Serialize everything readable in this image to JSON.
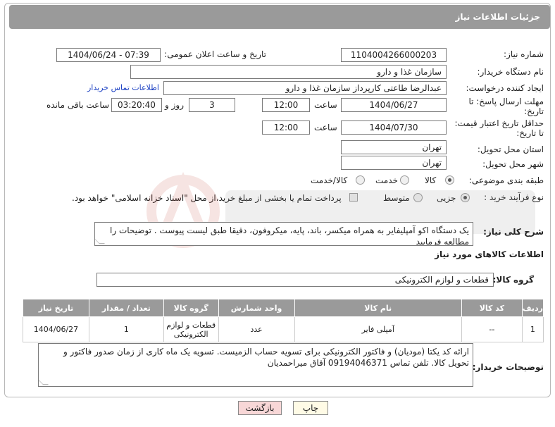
{
  "header": {
    "title": "جزئیات اطلاعات نیاز"
  },
  "form": {
    "need_number": {
      "label": "شماره نیاز:",
      "value": "1104004266000203"
    },
    "announce_datetime": {
      "label": "تاریخ و ساعت اعلان عمومی:",
      "value": "1404/06/24 - 07:39"
    },
    "buyer_org": {
      "label": "نام دستگاه خریدار:",
      "value": "سازمان غذا و دارو"
    },
    "requester": {
      "label": "ایجاد کننده درخواست:",
      "value": "عبدالرضا طاعتی کارپرداز سازمان غذا و دارو",
      "contact_link": "اطلاعات تماس خریدار"
    },
    "reply_deadline": {
      "label_line1": "مهلت ارسال پاسخ: تا",
      "label_line2": "تاریخ:",
      "date": "1404/06/27",
      "time_label": "ساعت",
      "time": "12:00",
      "days": "3",
      "days_label": "روز و",
      "remaining": "03:20:40",
      "remaining_label": "ساعت باقی مانده"
    },
    "price_validity": {
      "label_line1": "حداقل تاریخ اعتبار قیمت:",
      "label_line2": "تا تاریخ:",
      "date": "1404/07/30",
      "time_label": "ساعت",
      "time": "12:00"
    },
    "province": {
      "label": "استان محل تحویل:",
      "value": "تهران"
    },
    "city": {
      "label": "شهر محل تحویل:",
      "value": "تهران"
    },
    "category": {
      "label": "طبقه بندی موضوعی:",
      "options": [
        "کالا",
        "خدمت",
        "کالا/خدمت"
      ],
      "selected": "کالا"
    },
    "purchase_type": {
      "label": "نوع فرآیند خرید :",
      "options": [
        "جزیی",
        "متوسط"
      ],
      "selected": "جزیی",
      "payment_note": "پرداخت تمام یا بخشی از مبلغ خرید،از محل \"اسناد خزانه اسلامی\" خواهد بود."
    },
    "description": {
      "label": "شرح کلی نیاز:",
      "value": "یک دستگاه اکو آمپلیفایر به همراه میکسر، باند، پایه، میکروفون، دقیقا طبق لیست پیوست . توضیحات را مطالعه فرمایید"
    }
  },
  "goods_section": {
    "title": "اطلاعات کالاهای مورد نیاز",
    "group_label": "گروه کالا:",
    "group_value": "قطعات و لوازم الکترونیکی",
    "table": {
      "headers": [
        "ردیف",
        "کد کالا",
        "نام کالا",
        "واحد شمارش",
        "گروه کالا",
        "تعداد / مقدار",
        "تاریخ نیاز"
      ],
      "rows": [
        [
          "1",
          "--",
          "آمپلی فایر",
          "عدد",
          "قطعات و لوازم الکترونیکی",
          "1",
          "1404/06/27"
        ]
      ]
    }
  },
  "buyer_notes": {
    "label": "توضیحات خریدار:",
    "value": "ارائه کد یکتا (مودیان) و فاکتور الکترونیکی برای تسویه حساب الزمیست. تسویه یک ماه کاری از زمان صدور فاکتور و تحویل کالا. تلفن تماس 09194046371 آقاق میراحمدیان"
  },
  "buttons": {
    "print": "چاپ",
    "back": "بازگشت"
  },
  "colors": {
    "header_bg": "#9a9a9a",
    "link": "#1a3fc2",
    "back_button_bg": "#f8d7d7",
    "print_button_bg": "#fffbe6"
  }
}
